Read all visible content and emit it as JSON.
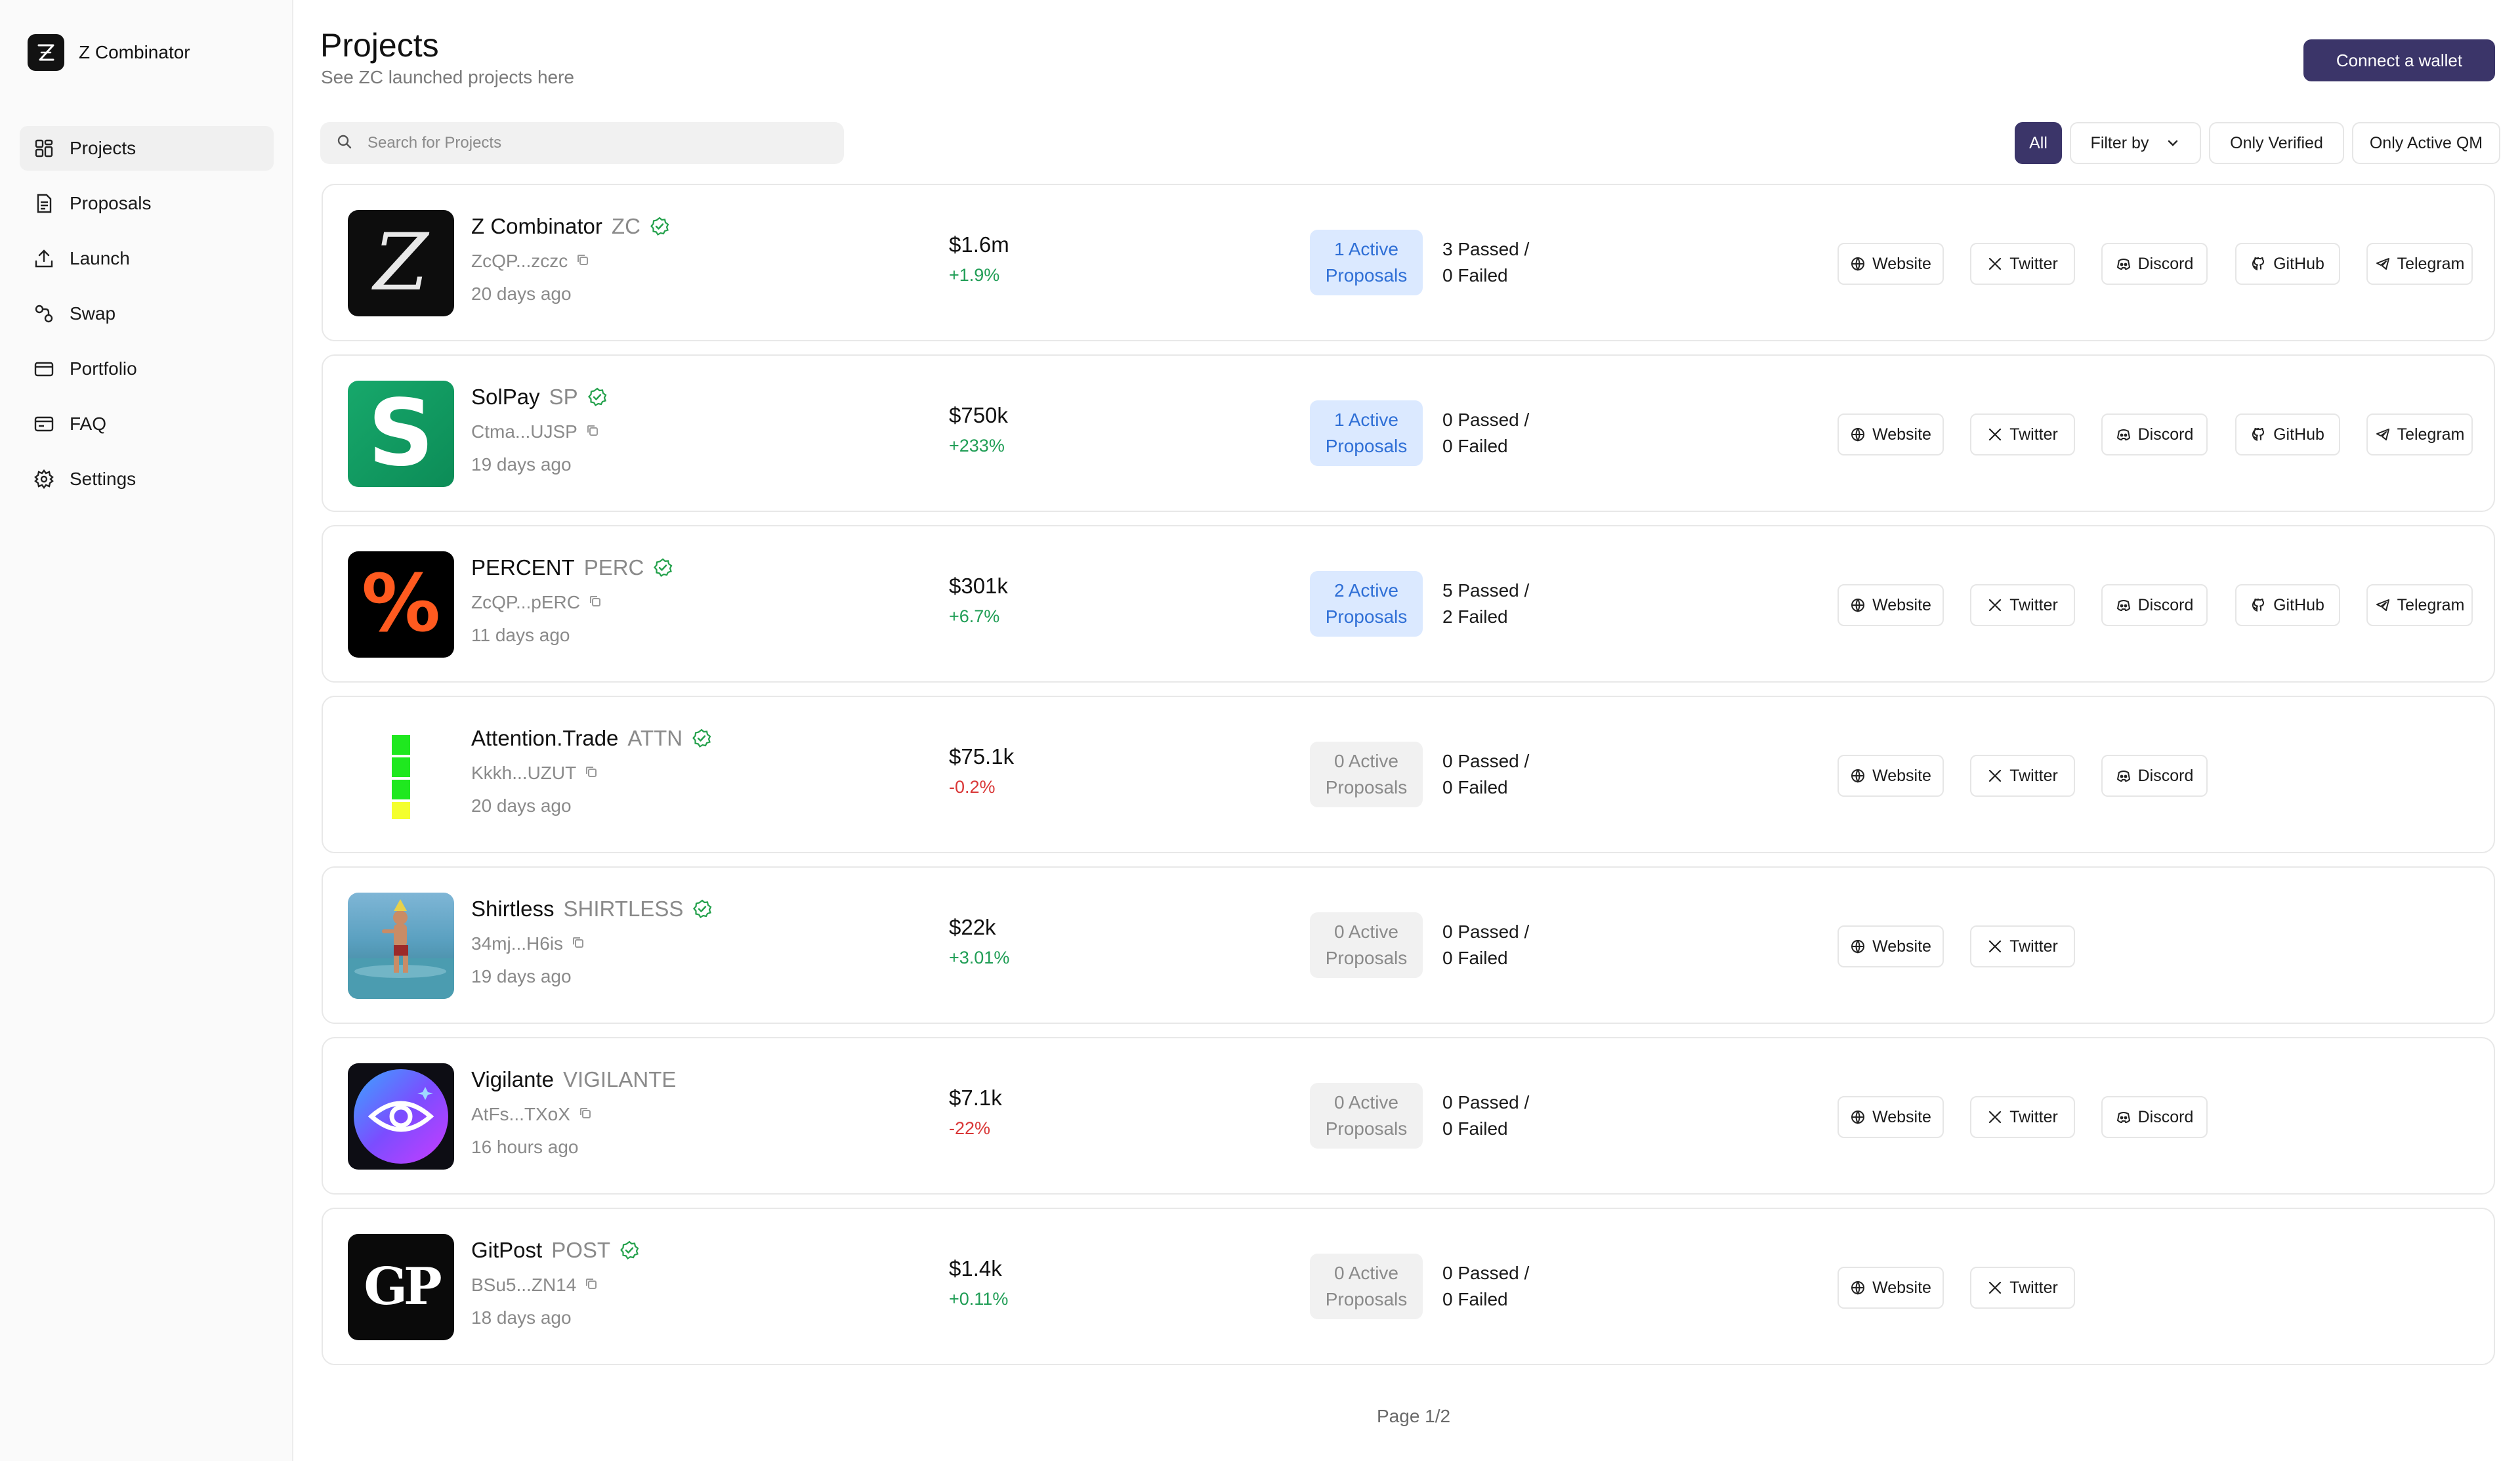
{
  "brand": {
    "name": "Z Combinator"
  },
  "sidebar": {
    "items": [
      {
        "label": "Projects",
        "icon": "grid-icon"
      },
      {
        "label": "Proposals",
        "icon": "document-icon"
      },
      {
        "label": "Launch",
        "icon": "upload-icon"
      },
      {
        "label": "Swap",
        "icon": "swap-icon"
      },
      {
        "label": "Portfolio",
        "icon": "wallet-icon"
      },
      {
        "label": "FAQ",
        "icon": "faq-card-icon"
      },
      {
        "label": "Settings",
        "icon": "gear-icon"
      }
    ]
  },
  "header": {
    "title": "Projects",
    "subtitle": "See ZC launched projects here",
    "connect_label": "Connect a wallet"
  },
  "search": {
    "placeholder": "Search for Projects"
  },
  "filters": {
    "all": "All",
    "filter_by": "Filter by",
    "only_verified": "Only Verified",
    "only_active_qm": "Only Active QM"
  },
  "projects": [
    {
      "name": "Z Combinator",
      "ticker": "ZC",
      "verified": true,
      "address": "ZcQP...zczc",
      "age": "20 days ago",
      "market_cap": "$1.6m",
      "change": "+1.9%",
      "change_dir": "up",
      "active": "1 Active\nProposals",
      "active_on": true,
      "results": "3 Passed /\n0 Failed",
      "links": [
        "Website",
        "Twitter",
        "Discord",
        "GitHub",
        "Telegram"
      ]
    },
    {
      "name": "SolPay",
      "ticker": "SP",
      "verified": true,
      "address": "Ctma...UJSP",
      "age": "19 days ago",
      "market_cap": "$750k",
      "change": "+233%",
      "change_dir": "up",
      "active": "1 Active\nProposals",
      "active_on": true,
      "results": "0 Passed /\n0 Failed",
      "links": [
        "Website",
        "Twitter",
        "Discord",
        "GitHub",
        "Telegram"
      ]
    },
    {
      "name": "PERCENT",
      "ticker": "PERC",
      "verified": true,
      "address": "ZcQP...pERC",
      "age": "11 days ago",
      "market_cap": "$301k",
      "change": "+6.7%",
      "change_dir": "up",
      "active": "2 Active\nProposals",
      "active_on": true,
      "results": "5 Passed /\n2 Failed",
      "links": [
        "Website",
        "Twitter",
        "Discord",
        "GitHub",
        "Telegram"
      ]
    },
    {
      "name": "Attention.Trade",
      "ticker": "ATTN",
      "verified": true,
      "address": "Kkkh...UZUT",
      "age": "20 days ago",
      "market_cap": "$75.1k",
      "change": "-0.2%",
      "change_dir": "down",
      "active": "0 Active\nProposals",
      "active_on": false,
      "results": "0 Passed /\n0 Failed",
      "links": [
        "Website",
        "Twitter",
        "Discord"
      ]
    },
    {
      "name": "Shirtless",
      "ticker": "SHIRTLESS",
      "verified": true,
      "address": "34mj...H6is",
      "age": "19 days ago",
      "market_cap": "$22k",
      "change": "+3.01%",
      "change_dir": "up",
      "active": "0 Active\nProposals",
      "active_on": false,
      "results": "0 Passed /\n0 Failed",
      "links": [
        "Website",
        "Twitter"
      ]
    },
    {
      "name": "Vigilante",
      "ticker": "VIGILANTE",
      "verified": false,
      "address": "AtFs...TXoX",
      "age": "16 hours ago",
      "market_cap": "$7.1k",
      "change": "-22%",
      "change_dir": "down",
      "active": "0 Active\nProposals",
      "active_on": false,
      "results": "0 Passed /\n0 Failed",
      "links": [
        "Website",
        "Twitter",
        "Discord"
      ]
    },
    {
      "name": "GitPost",
      "ticker": "POST",
      "verified": true,
      "address": "BSu5...ZN14",
      "age": "18 days ago",
      "market_cap": "$1.4k",
      "change": "+0.11%",
      "change_dir": "up",
      "active": "0 Active\nProposals",
      "active_on": false,
      "results": "0 Passed /\n0 Failed",
      "links": [
        "Website",
        "Twitter"
      ]
    }
  ],
  "pagination": {
    "label": "Page 1/2"
  },
  "logos": {
    "zc_letter": "Z",
    "solpay_letter": "S",
    "percent_glyph": "%",
    "gitpost_letters": "GP"
  },
  "colors": {
    "accent": "#3b3569",
    "active_badge_bg": "#dbe9ff",
    "active_badge_text": "#2f6fd6",
    "positive": "#1f9d55",
    "negative": "#d93636",
    "verified": "#22a04a"
  }
}
